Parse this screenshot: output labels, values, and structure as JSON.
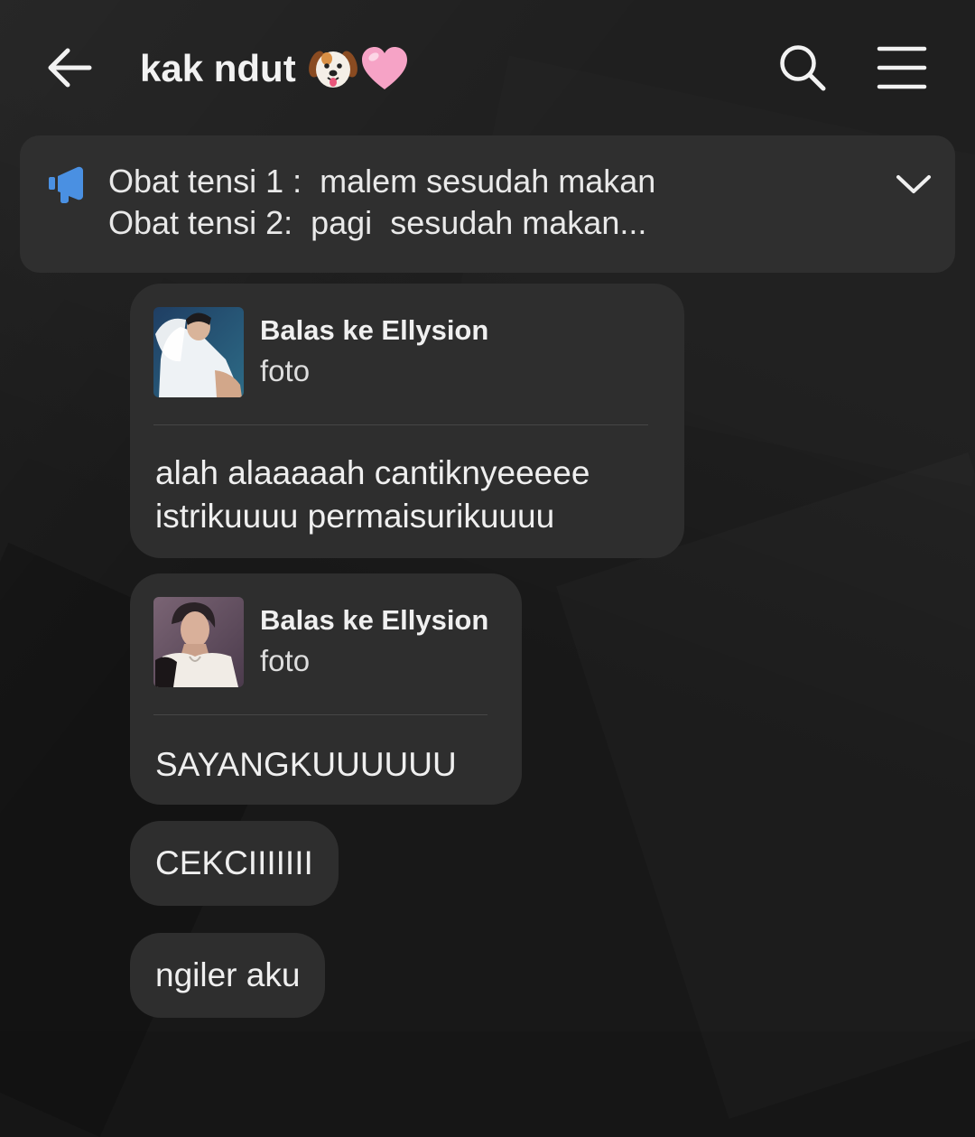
{
  "header": {
    "title": "kak ndut",
    "back_icon": "arrow-left-icon",
    "search_icon": "search-icon",
    "menu_icon": "hamburger-menu-icon",
    "title_emojis": [
      "dog-face-emoji",
      "pink-heart-emoji"
    ]
  },
  "pinned": {
    "icon": "megaphone-icon",
    "icon_color": "#4a90e2",
    "line1": "Obat tensi 1 :  malem sesudah makan",
    "line2": "Obat tensi 2:  pagi  sesudah makan...",
    "expand_icon": "chevron-down-icon"
  },
  "messages": [
    {
      "reply_to": "Balas ke Ellysion",
      "reply_type": "foto",
      "text_line1": "alah alaaaaah cantiknyeeeee",
      "text_line2": "istrikuuuu permaisurikuuuu"
    },
    {
      "reply_to": "Balas ke Ellysion",
      "reply_type": "foto",
      "text_line1": "SAYANGKUUUUUU"
    },
    {
      "text": "CEKCIIIIIII"
    },
    {
      "text": "ngiler aku"
    }
  ],
  "colors": {
    "background": "#181818",
    "bubble": "#2e2e2e",
    "pinned_bar": "#2f2f2f",
    "text": "#ececec"
  }
}
